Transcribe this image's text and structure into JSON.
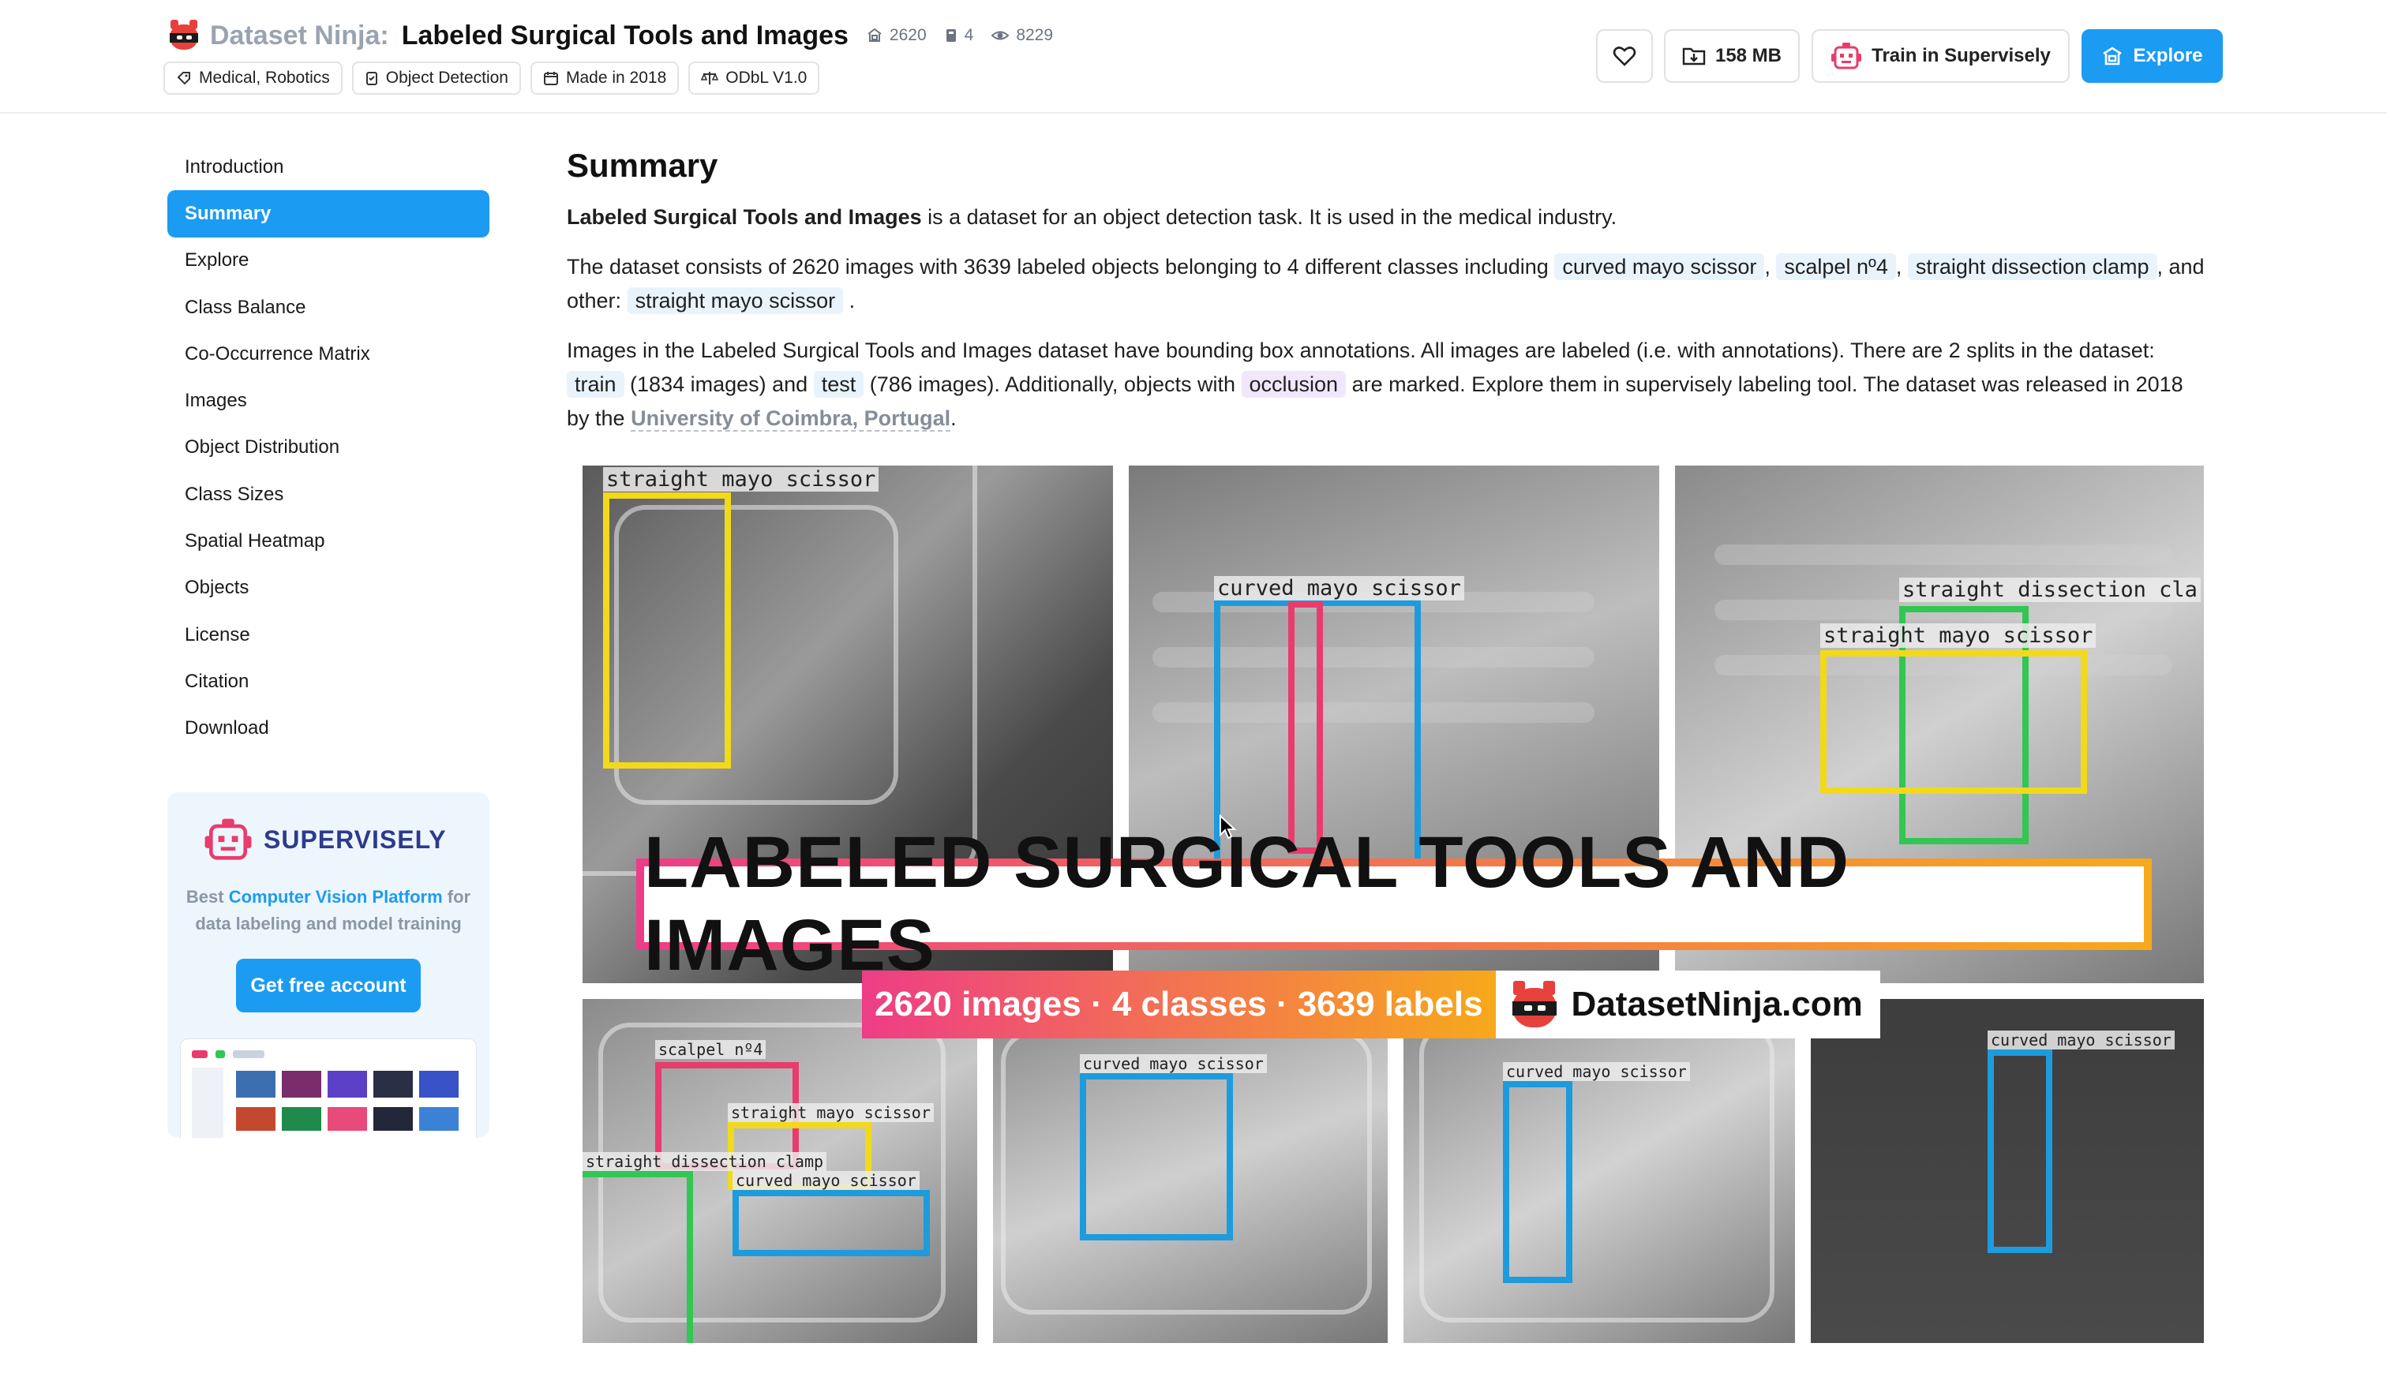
{
  "header": {
    "brand": "Dataset Ninja:",
    "title": "Labeled Surgical Tools and Images",
    "stats": {
      "images": "2620",
      "classes": "4",
      "views": "8229"
    },
    "tags": [
      "Medical, Robotics",
      "Object Detection",
      "Made in 2018",
      "ODbL V1.0"
    ],
    "download_size": "158 MB",
    "train_label": "Train in Supervisely",
    "explore_label": "Explore"
  },
  "sidebar": {
    "items": [
      "Introduction",
      "Summary",
      "Explore",
      "Class Balance",
      "Co-Occurrence Matrix",
      "Images",
      "Object Distribution",
      "Class Sizes",
      "Spatial Heatmap",
      "Objects",
      "License",
      "Citation",
      "Download"
    ],
    "active": "Summary"
  },
  "promo": {
    "logo_word": "SUPERVISELY",
    "text_prefix": "Best",
    "text_highlight": "Computer Vision Platform",
    "text_suffix": "for data labeling and model training",
    "button": "Get free account"
  },
  "summary": {
    "heading": "Summary",
    "p1_bold": "Labeled Surgical Tools and Images",
    "p1_rest": "is a dataset for an object detection task. It is used in the medical industry.",
    "p2_a": "The dataset consists of 2620 images with 3639 labeled objects belonging to 4 different classes including",
    "classes": [
      "curved mayo scissor",
      "scalpel nº4",
      "straight dissection clamp",
      "straight mayo scissor"
    ],
    "p2_b": ", and other:",
    "p3_a": "Images in the Labeled Surgical Tools and Images dataset have bounding box annotations. All images are labeled (i.e. with annotations). There are 2 splits in the dataset:",
    "split_train": "train",
    "p3_b": "(1834 images) and",
    "split_test": "test",
    "p3_c": "(786 images). Additionally, objects with",
    "tag_occlusion": "occlusion",
    "p3_d": "are marked. Explore them in supervisely labeling tool. The dataset was released in 2018 by the",
    "institution": "University of Coimbra, Portugal",
    "p3_end": "."
  },
  "hero": {
    "banner": "LABELED SURGICAL TOOLS AND IMAGES",
    "counts": "2620 images · 4 classes · 3639 labels",
    "site": "DatasetNinja.com",
    "labels": {
      "sms": "straight mayo scissor",
      "cms": "curved mayo scissor",
      "scalpel": "scalpel nº4",
      "sdc_trunc": "straight dissection cla",
      "sdc2": "straight dissection clamp"
    }
  },
  "colors": {
    "accent": "#1c9bf2",
    "yellow": "#f2d91b",
    "blue": "#1e9bdc",
    "red": "#e83c6d",
    "green": "#32c653"
  }
}
